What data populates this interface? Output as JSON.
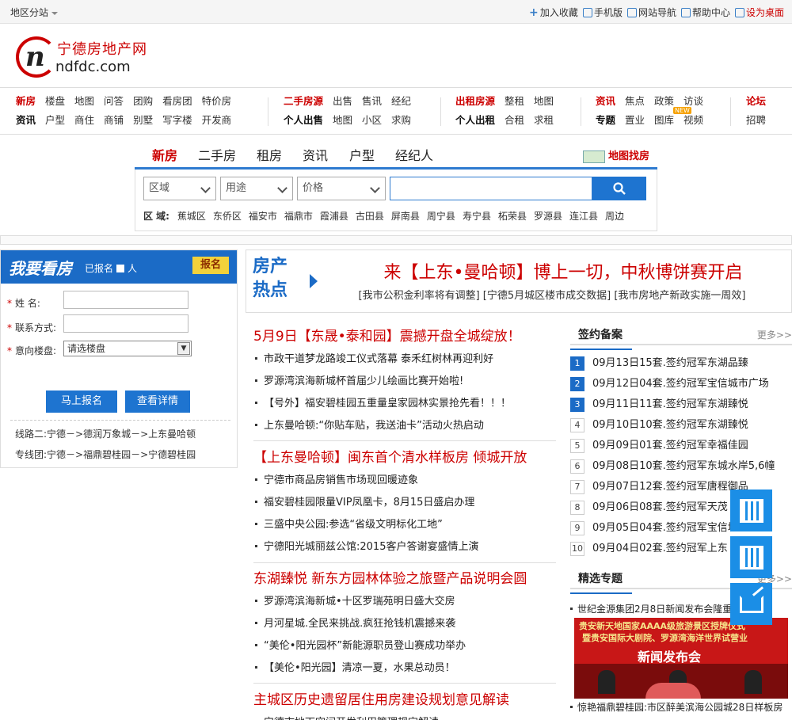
{
  "topbar": {
    "region": "地区分站",
    "links": [
      {
        "label": "加入收藏",
        "icon": "plus-icon"
      },
      {
        "label": "手机版",
        "icon": "mobile-icon"
      },
      {
        "label": "网站导航",
        "icon": "grid-icon"
      },
      {
        "label": "帮助中心",
        "icon": "help-icon"
      },
      {
        "label": "设为桌面",
        "icon": "desktop-icon"
      }
    ]
  },
  "logo": {
    "cn": "宁德房地产网",
    "en": "ndfdc.com",
    "mark": "n"
  },
  "nav": {
    "g1": {
      "r1": [
        "新房",
        "楼盘",
        "地图",
        "问答",
        "团购",
        "看房团",
        "特价房"
      ],
      "r2": [
        "资讯",
        "户型",
        "商住",
        "商铺",
        "别墅",
        "写字楼",
        "开发商"
      ]
    },
    "g2": {
      "r1": [
        "二手房源",
        "出售",
        "售讯",
        "经纪"
      ],
      "r2": [
        "个人出售",
        "地图",
        "小区",
        "求购"
      ]
    },
    "g3": {
      "r1": [
        "出租房源",
        "整租",
        "地图"
      ],
      "r2": [
        "个人出租",
        "合租",
        "求租"
      ]
    },
    "g4": {
      "r1": [
        "资讯",
        "焦点",
        "政策",
        "访谈"
      ],
      "r2": [
        "专题",
        "置业",
        "图库",
        "视频"
      ]
    },
    "g5": {
      "r1": [
        "论坛"
      ],
      "r2": [
        "招聘"
      ]
    },
    "new_badge": "NEW"
  },
  "search": {
    "tabs": [
      "新房",
      "二手房",
      "租房",
      "资讯",
      "户型",
      "经纪人"
    ],
    "map_link": "地图找房",
    "selects": [
      "区域",
      "用途",
      "价格"
    ],
    "districts_label": "区  域:",
    "districts": [
      "蕉城区",
      "东侨区",
      "福安市",
      "福鼎市",
      "霞浦县",
      "古田县",
      "屏南县",
      "周宁县",
      "寿宁县",
      "柘荣县",
      "罗源县",
      "连江县",
      "周边"
    ]
  },
  "kanfang": {
    "title": "我要看房",
    "count_pre": "已报名",
    "count_post": "人",
    "signup": "报名",
    "name_label": "姓    名:",
    "contact_label": "联系方式:",
    "house_label": "意向楼盘:",
    "house_select": "请选楼盘",
    "btn_signup": "马上报名",
    "btn_detail": "查看详情",
    "routes": [
      "线路二:宁德－>德润万象城－>上东曼哈顿",
      "专线团:宁德－>福鼎碧桂园－>宁德碧桂园"
    ]
  },
  "hot": {
    "label": "房产热点",
    "title": "来【上东•曼哈顿】博上一切，中秋博饼赛开启",
    "sub": "[我市公积金利率将有调整] [宁德5月城区楼市成交数据] [我市房地产新政实施一周效]"
  },
  "news": [
    {
      "head": "5月9日【东晟•泰和园】震撼开盘全城绽放！",
      "items": [
        "市政干道梦龙路竣工仪式落幕 泰禾红树林再迎利好",
        "罗源湾滨海新城杯首届少儿绘画比赛开始啦!",
        "【号外】福安碧桂园五重量皇家园林实景抢先看！！！",
        "上东曼哈顿:“你贴车贴，我送油卡”活动火热启动"
      ]
    },
    {
      "head": "【上东曼哈顿】闽东首个清水样板房 倾城开放",
      "items": [
        "宁德市商品房销售市场现回暖迹象",
        "福安碧桂园限量VIP凤凰卡，8月15日盛启办理",
        "三盛中央公园:参选“省级文明标化工地”",
        "宁德阳光城丽兹公馆:2015客户答谢宴盛情上演"
      ]
    },
    {
      "head": "东湖臻悦 新东方园林体验之旅暨产品说明会圆",
      "items": [
        "罗源湾滨海新城•十区罗瑞苑明日盛大交房",
        "月河星城.全民来挑战.疯狂抢钱机震撼来袭",
        "“美伦•阳光园杯”新能源职员登山赛成功举办",
        "【美伦•阳光园】清凉一夏，水果总动员！"
      ]
    },
    {
      "head": "主城区历史遗留居住用房建设规划意见解读",
      "items": [
        "宁德市地下空间开发利用管理规定解读"
      ]
    }
  ],
  "qianyue": {
    "title": "签约备案",
    "more": "更多>>",
    "items": [
      {
        "no": "1",
        "text": "09月13日15套.签约冠军东湖品臻"
      },
      {
        "no": "2",
        "text": "09月12日04套.签约冠军宝信城市广场"
      },
      {
        "no": "3",
        "text": "09月11日11套.签约冠军东湖臻悦"
      },
      {
        "no": "4",
        "text": "09月10日10套.签约冠军东湖臻悦"
      },
      {
        "no": "5",
        "text": "09月09日01套.签约冠军幸福佳园"
      },
      {
        "no": "6",
        "text": "09月08日10套.签约冠军东城水岸5,6幢"
      },
      {
        "no": "7",
        "text": "09月07日12套.签约冠军唐程御品"
      },
      {
        "no": "8",
        "text": "09月06日08套.签约冠军天茂"
      },
      {
        "no": "9",
        "text": "09月05日04套.签约冠军宝信城"
      },
      {
        "no": "10",
        "text": "09月04日02套.签约冠军上东"
      }
    ]
  },
  "zhuanti": {
    "title": "精选专题",
    "more": "更多>>",
    "top": "世纪金源集团2月8日新闻发布会隆重",
    "banner_l1": "贵安新天地国家AAAA级旅游景区授牌仪式",
    "banner_l2": "暨贵安国际大剧院、罗源湾海洋世界试营业",
    "banner_l3": "新闻发布会",
    "bottom": "惊艳福鼎碧桂园:市区醉美滨海公园城28日样板房"
  }
}
